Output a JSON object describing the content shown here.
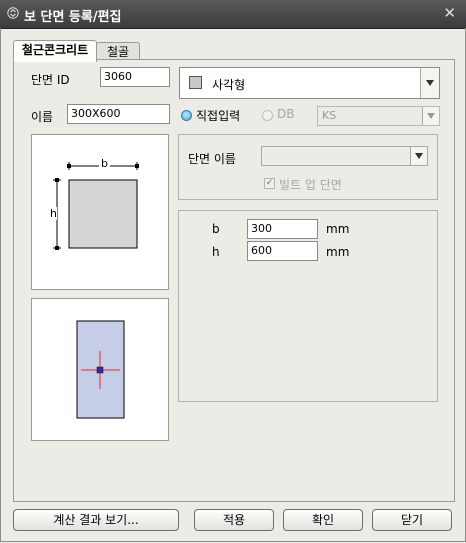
{
  "window": {
    "title": "보 단면 등록/편집"
  },
  "tabs": [
    {
      "label": "철근콘크리트",
      "active": true
    },
    {
      "label": "철골",
      "active": false
    }
  ],
  "section_id": {
    "label": "단면 ID",
    "value": "3060"
  },
  "name": {
    "label": "이름",
    "value": "300X600"
  },
  "shape_select": {
    "value": "사각형"
  },
  "input_mode": {
    "direct_label": "직접입력",
    "direct_selected": true,
    "db_label": "DB",
    "db_selected": false,
    "db_value": "KS"
  },
  "db_group": {
    "section_name_label": "단면 이름",
    "section_name_value": "",
    "built_up_label": "빌트 업 단면",
    "built_up_checked": true
  },
  "diagram": {
    "b_label": "b",
    "h_label": "h"
  },
  "dims": [
    {
      "label": "b",
      "value": "300",
      "unit": "mm"
    },
    {
      "label": "h",
      "value": "600",
      "unit": "mm"
    }
  ],
  "buttons": {
    "calc": "계산 결과 보기...",
    "apply": "적용",
    "ok": "확인",
    "close": "닫기"
  },
  "colors": {
    "accent_radio": "#4aa7d9",
    "section_fill": "#c6cde6",
    "crosshair": "#e0302a"
  }
}
